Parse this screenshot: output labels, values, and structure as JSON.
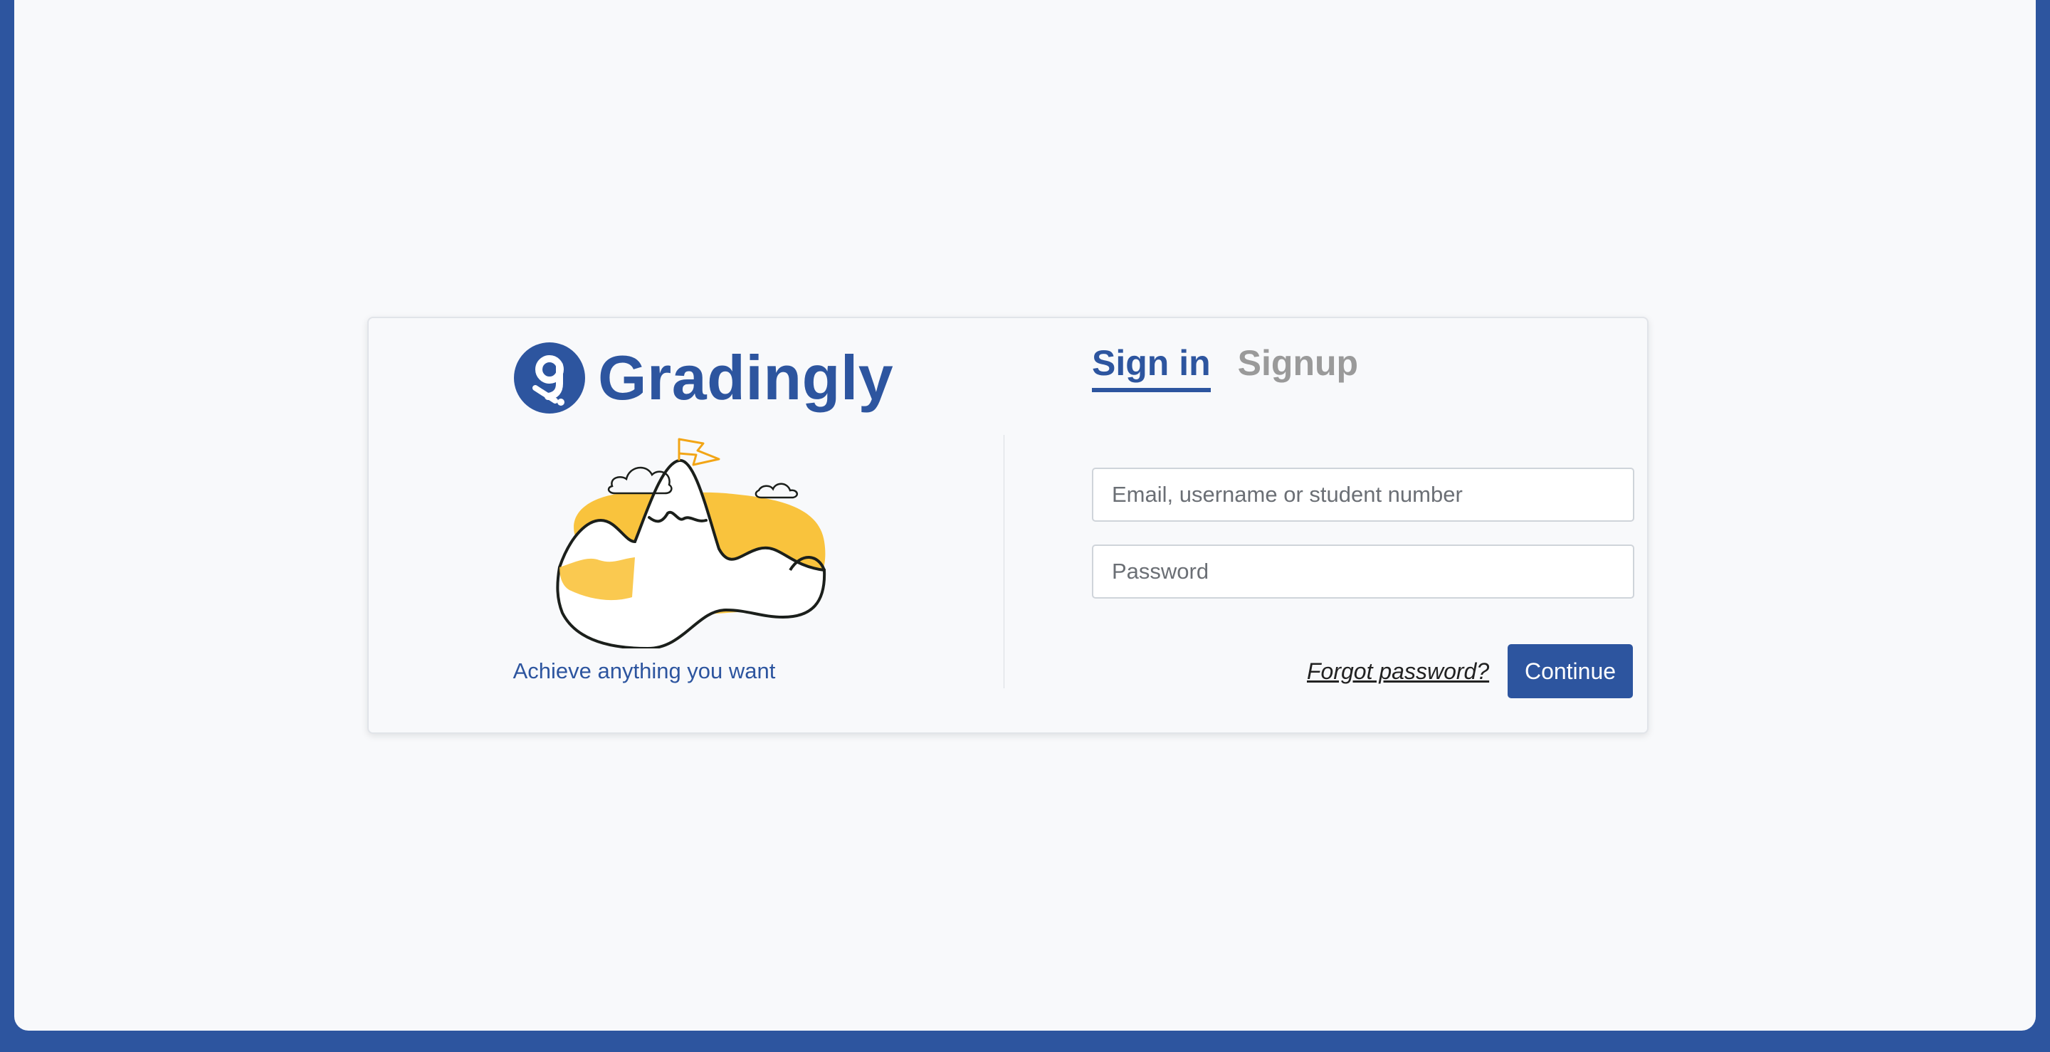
{
  "brand": {
    "name": "Gradingly",
    "tagline": "Achieve anything you want",
    "primary_color": "#2d559f",
    "accent_color": "#f9c33d"
  },
  "auth": {
    "tabs": [
      {
        "label": "Sign in",
        "active": true
      },
      {
        "label": "Signup",
        "active": false
      }
    ],
    "email_placeholder": "Email, username or student number",
    "password_placeholder": "Password",
    "forgot_label": "Forgot password?",
    "continue_label": "Continue"
  },
  "icons": {
    "logo": "gradingly-logo-icon",
    "illustration": "mountain-flag-illustration"
  }
}
